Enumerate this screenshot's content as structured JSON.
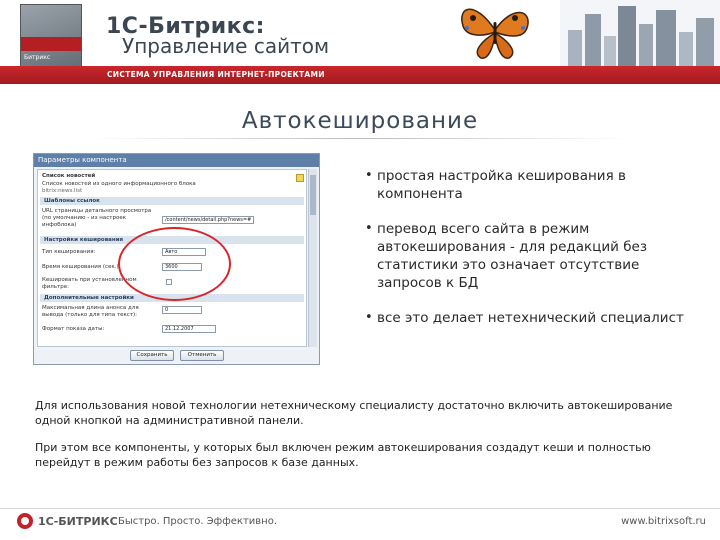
{
  "header": {
    "logo_tiny": "Битрикс",
    "brand_title": "1С-Битрикс:",
    "brand_subtitle": "Управление сайтом",
    "tagline": "СИСТЕМА УПРАВЛЕНИЯ ИНТЕРНЕТ-ПРОЕКТАМИ"
  },
  "slide": {
    "title": "Автокеширование"
  },
  "screenshot": {
    "window_title": "Параметры компонента",
    "component_name": "Список новостей",
    "component_desc": "Список новостей из одного информационного блока",
    "component_path": "bitrix:news.list",
    "section_templates": "Шаблоны ссылок",
    "url_label": "URL страницы детального просмотра (по умолчанию - из настроек инфоблока)",
    "url_value": "/content/news/detail.php?news=#",
    "section_cache": "Настройки кеширования",
    "cache_type_label": "Тип кеширования:",
    "cache_type_value": "Авто",
    "cache_time_label": "Время кеширования (сек.):",
    "cache_time_value": "3600",
    "cache_filter_label": "Кешировать при установленном фильтре:",
    "section_additional": "Дополнительные настройки",
    "max_len_label": "Максимальная длина анонса для вывода (только для типа текст):",
    "max_len_value": "0",
    "date_label": "Формат показа даты:",
    "date_value": "21.12.2007",
    "save_button": "Сохранить",
    "cancel_button": "Отменить"
  },
  "bullets": [
    "простая настройка кеширования в компонента",
    "перевод всего сайта в режим автокеширования - для редакций без статистики это означает отсутствие запросов к БД",
    "все это делает нетехнический специалист"
  ],
  "paragraphs": {
    "p1": "Для использования новой технологии нетехническому специалисту достаточно включить автокеширование одной кнопкой на административной панели.",
    "p2": "При этом все компоненты, у которых был включен режим автокеширования создадут кеши и полностью перейдут в режим работы без запросов к базе данных."
  },
  "footer": {
    "brand": "1С-БИТРИКС",
    "slogan": "Быстро. Просто. Эффективно.",
    "url": "www.bitrixsoft.ru"
  }
}
